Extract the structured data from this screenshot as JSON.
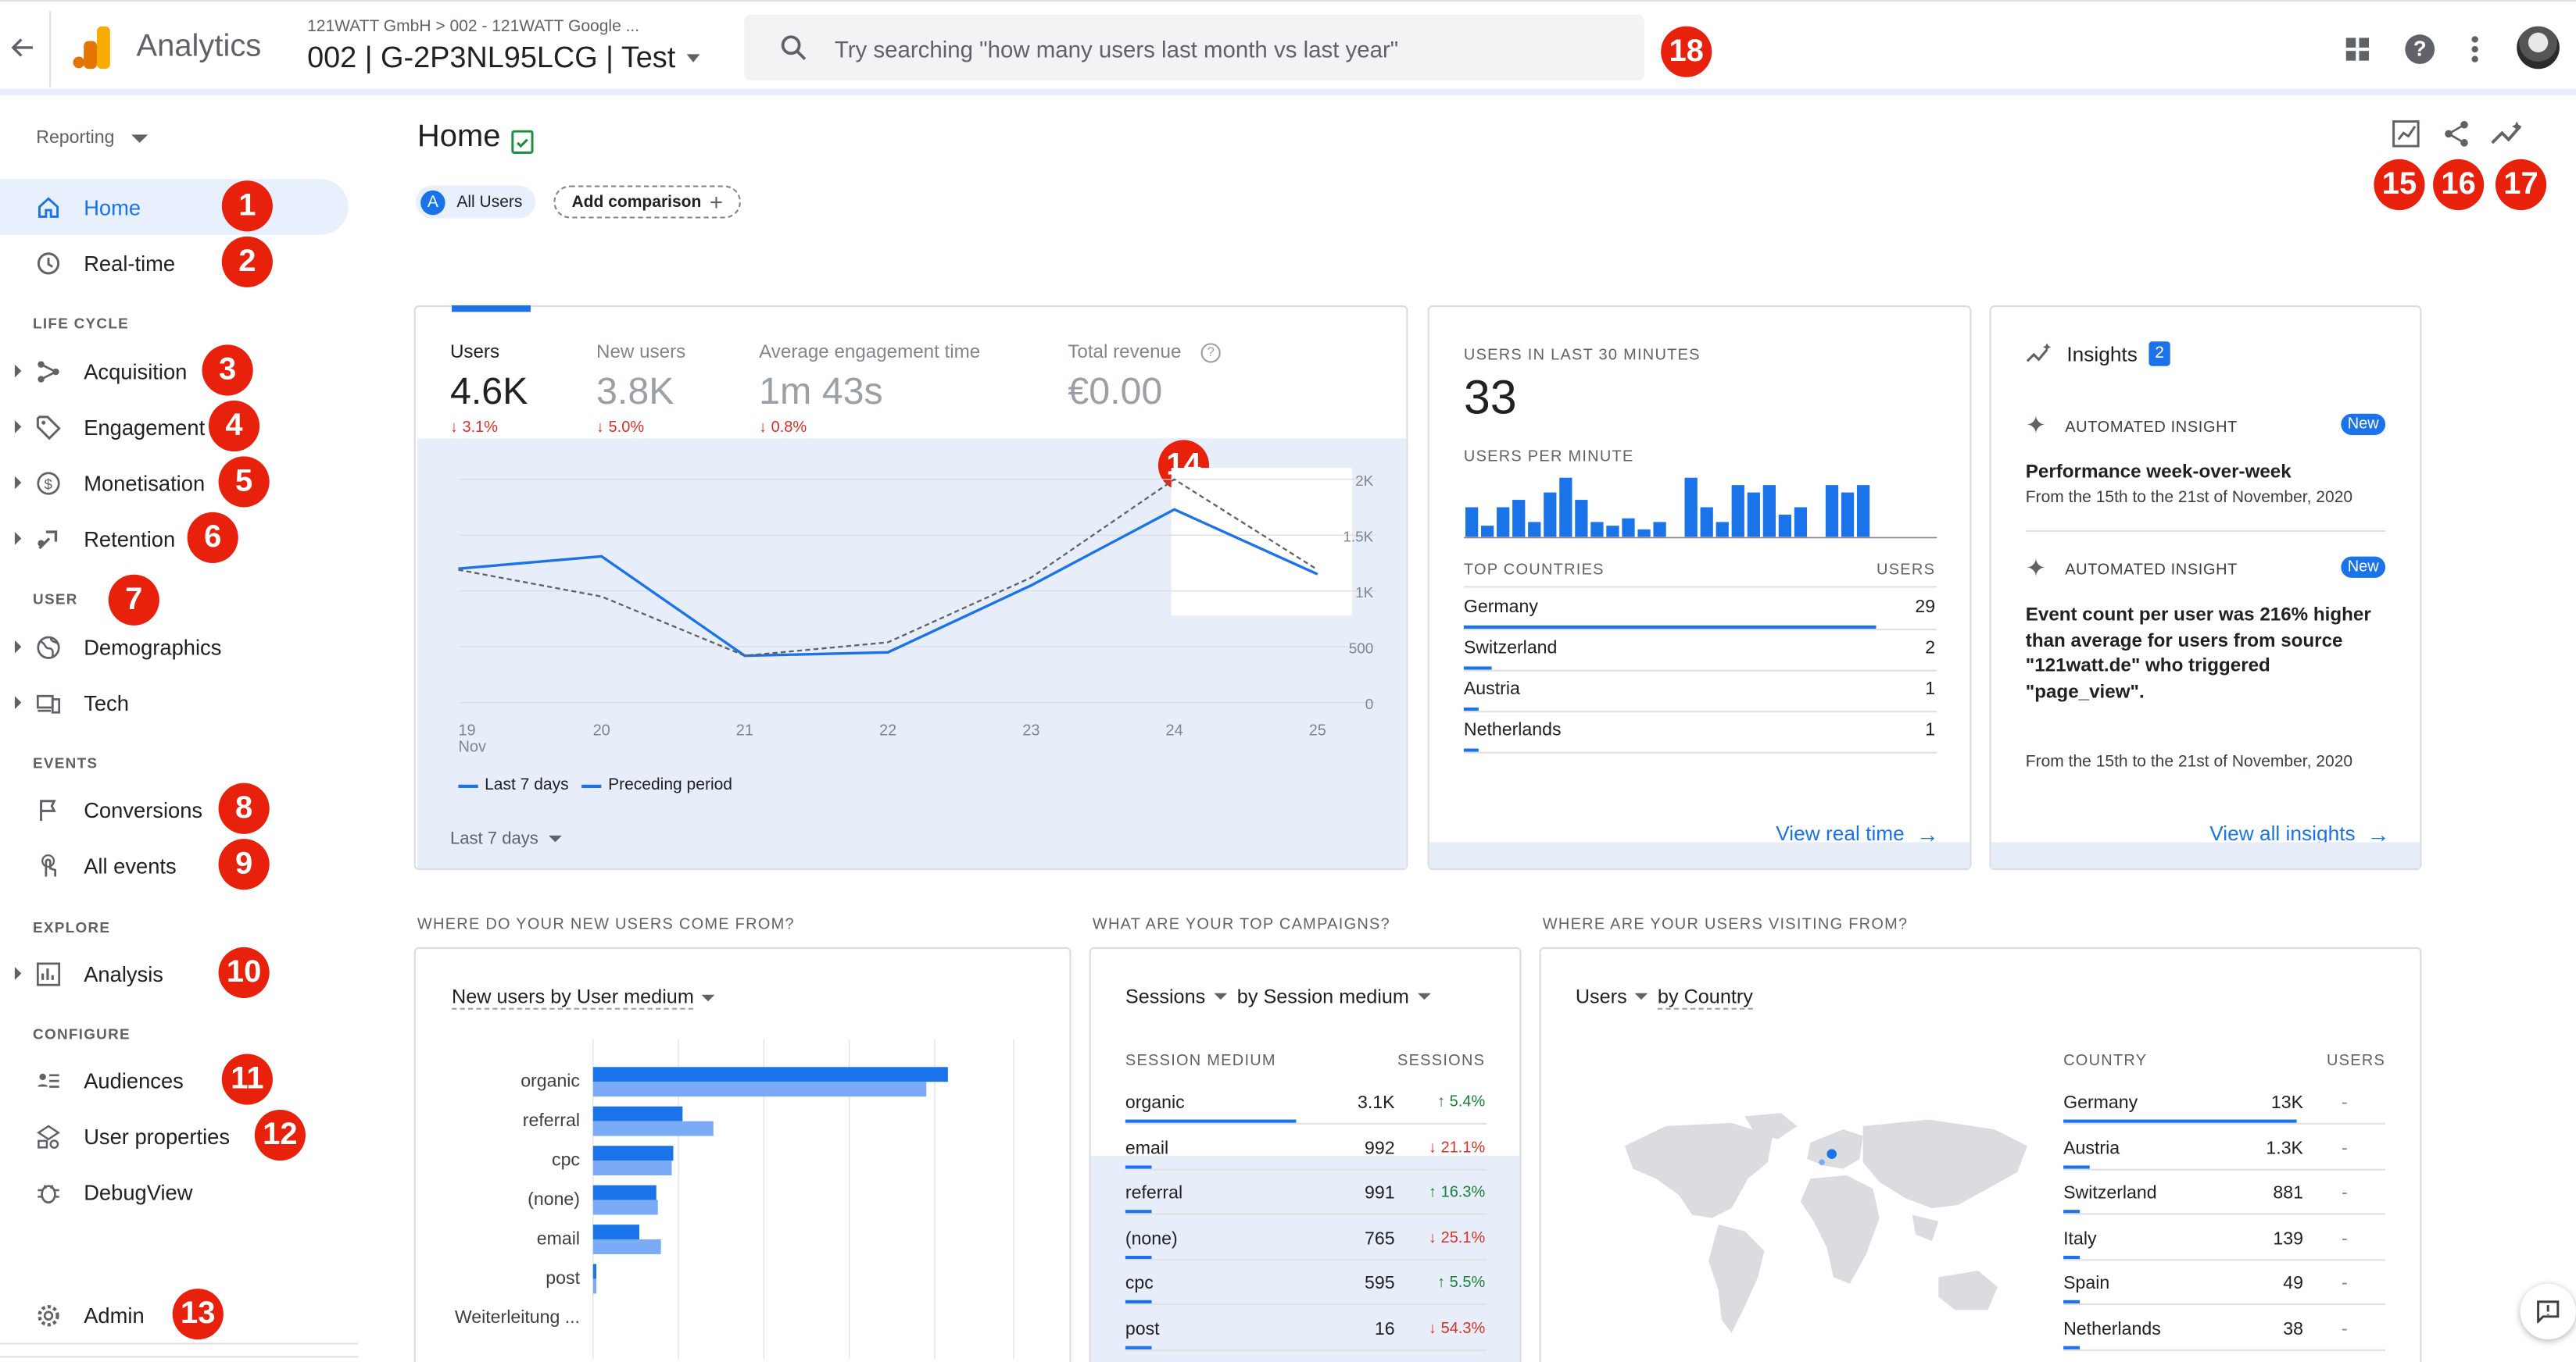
{
  "header": {
    "back_icon": "arrow-left-icon",
    "app_name": "Analytics",
    "breadcrumb": "121WATT GmbH > 002 - 121WATT Google ...",
    "property": "002 | G-2P3NL95LCG | Test",
    "search_placeholder": "Try searching \"how many users last month vs last year\"",
    "icons": [
      "apps-grid-icon",
      "help-icon",
      "more-vert-icon",
      "avatar"
    ]
  },
  "sidebar": {
    "reporting": "Reporting",
    "items": [
      {
        "label": "Home",
        "badge": "1",
        "icon": "home-icon",
        "active": true
      },
      {
        "label": "Real-time",
        "badge": "2",
        "icon": "clock-icon"
      },
      {
        "label": "Acquisition",
        "badge": "3",
        "icon": "acquisition-icon"
      },
      {
        "label": "Engagement",
        "badge": "4",
        "icon": "tag-icon"
      },
      {
        "label": "Monetisation",
        "badge": "5",
        "icon": "dollar-icon"
      },
      {
        "label": "Retention",
        "badge": "6",
        "icon": "retention-icon"
      },
      {
        "label": "Demographics",
        "icon": "globe-icon"
      },
      {
        "label": "Tech",
        "icon": "devices-icon"
      },
      {
        "label": "Conversions",
        "badge": "8",
        "icon": "flag-icon"
      },
      {
        "label": "All events",
        "badge": "9",
        "icon": "touch-icon"
      },
      {
        "label": "Analysis",
        "badge": "10",
        "icon": "analysis-icon"
      },
      {
        "label": "Audiences",
        "badge": "11",
        "icon": "audiences-icon"
      },
      {
        "label": "User properties",
        "badge": "12",
        "icon": "user-properties-icon"
      },
      {
        "label": "DebugView",
        "icon": "debug-icon"
      },
      {
        "label": "Admin",
        "badge": "13",
        "icon": "gear-icon"
      }
    ],
    "sections": {
      "life_cycle": "LIFE CYCLE",
      "user": "USER",
      "user_badge": "7",
      "events": "EVENTS",
      "explore": "EXPLORE",
      "configure": "CONFIGURE"
    }
  },
  "page": {
    "title": "Home",
    "all_users_letter": "A",
    "all_users": "All Users",
    "add_comparison": "Add comparison",
    "badges": {
      "b14": "14",
      "b15": "15",
      "b16": "16",
      "b17": "17",
      "b18": "18"
    }
  },
  "overview": {
    "metrics": [
      {
        "label": "Users",
        "value": "4.6K",
        "change": "↓ 3.1%"
      },
      {
        "label": "New users",
        "value": "3.8K",
        "change": "↓ 5.0%"
      },
      {
        "label": "Average engagement time",
        "value": "1m 43s",
        "change": "↓ 0.8%"
      },
      {
        "label": "Total revenue",
        "value": "€0.00",
        "change": ""
      }
    ],
    "legend_last": "Last 7 days",
    "legend_prev": "Preceding period",
    "range": "Last 7 days"
  },
  "chart_data": [
    {
      "type": "line",
      "x": [
        "19 Nov",
        "20",
        "21",
        "22",
        "23",
        "24",
        "25"
      ],
      "series": [
        {
          "name": "Last 7 days",
          "values": [
            1200,
            1310,
            420,
            450,
            1050,
            1730,
            1150
          ]
        },
        {
          "name": "Preceding period",
          "values": [
            1190,
            950,
            420,
            540,
            1120,
            2000,
            1190
          ]
        }
      ],
      "y_ticks": [
        "2K",
        "1.5K",
        "1K",
        "500",
        "0"
      ],
      "ylim": [
        0,
        2000
      ]
    },
    {
      "type": "bar",
      "title": "USERS PER MINUTE",
      "values": [
        8,
        3,
        8,
        10,
        4,
        12,
        16,
        10,
        4,
        3,
        5,
        2,
        4,
        0,
        16,
        8,
        4,
        14,
        12,
        14,
        6,
        8,
        0,
        14,
        12,
        14,
        0,
        0,
        0,
        0
      ]
    },
    {
      "type": "bar",
      "title": "New users by User medium",
      "categories": [
        "organic",
        "referral",
        "cpc",
        "(none)",
        "email",
        "post",
        "Weiterleitung ..."
      ],
      "series": [
        {
          "name": "Last 7 days",
          "values": [
            2300,
            580,
            520,
            410,
            300,
            20,
            0
          ]
        },
        {
          "name": "Preceding period",
          "values": [
            2160,
            780,
            510,
            420,
            440,
            20,
            0
          ]
        }
      ]
    }
  ],
  "realtime": {
    "title": "USERS IN LAST 30 MINUTES",
    "value": "33",
    "per_minute": "USERS PER MINUTE",
    "countries_h": "TOP COUNTRIES",
    "users_h": "USERS",
    "rows": [
      {
        "c": "Germany",
        "v": "29",
        "p": 0.87
      },
      {
        "c": "Switzerland",
        "v": "2",
        "p": 0.06
      },
      {
        "c": "Austria",
        "v": "1",
        "p": 0.03
      },
      {
        "c": "Netherlands",
        "v": "1",
        "p": 0.03
      }
    ],
    "link": "View real time"
  },
  "insights": {
    "title": "Insights",
    "count": "2",
    "items": [
      {
        "kind": "AUTOMATED INSIGHT",
        "new": "New",
        "title": "Performance week-over-week",
        "sub": "From the 15th to the 21st of November, 2020"
      },
      {
        "kind": "AUTOMATED INSIGHT",
        "new": "New",
        "title": "Event count per user was 216% higher than average for users from source \"121watt.de\" who triggered \"page_view\".",
        "sub": "From the 15th to the 21st of November, 2020"
      }
    ],
    "link": "View all insights"
  },
  "sections_lower": {
    "new_users_q": "WHERE DO YOUR NEW USERS COME FROM?",
    "campaigns_q": "WHAT ARE YOUR TOP CAMPAIGNS?",
    "visiting_q": "WHERE ARE YOUR USERS VISITING FROM?"
  },
  "medium_card": {
    "title": "New users by User medium"
  },
  "campaigns": {
    "sel1": "Sessions",
    "sel2": "by Session medium",
    "h1": "SESSION MEDIUM",
    "h2": "SESSIONS",
    "rows": [
      {
        "m": "organic",
        "v": "3.1K",
        "c": "↑ 5.4%",
        "up": true
      },
      {
        "m": "email",
        "v": "992",
        "c": "↓ 21.1%",
        "up": false
      },
      {
        "m": "referral",
        "v": "991",
        "c": "↑ 16.3%",
        "up": true
      },
      {
        "m": "(none)",
        "v": "765",
        "c": "↓ 25.1%",
        "up": false
      },
      {
        "m": "cpc",
        "v": "595",
        "c": "↑ 5.5%",
        "up": true
      },
      {
        "m": "post",
        "v": "16",
        "c": "↓ 54.3%",
        "up": false
      }
    ]
  },
  "countries": {
    "sel1": "Users",
    "sel2": "by Country",
    "h1": "COUNTRY",
    "h2": "USERS",
    "rows": [
      {
        "c": "Germany",
        "v": "13K",
        "d": "-"
      },
      {
        "c": "Austria",
        "v": "1.3K",
        "d": "-"
      },
      {
        "c": "Switzerland",
        "v": "881",
        "d": "-"
      },
      {
        "c": "Italy",
        "v": "139",
        "d": "-"
      },
      {
        "c": "Spain",
        "v": "49",
        "d": "-"
      },
      {
        "c": "Netherlands",
        "v": "38",
        "d": "-"
      }
    ]
  }
}
